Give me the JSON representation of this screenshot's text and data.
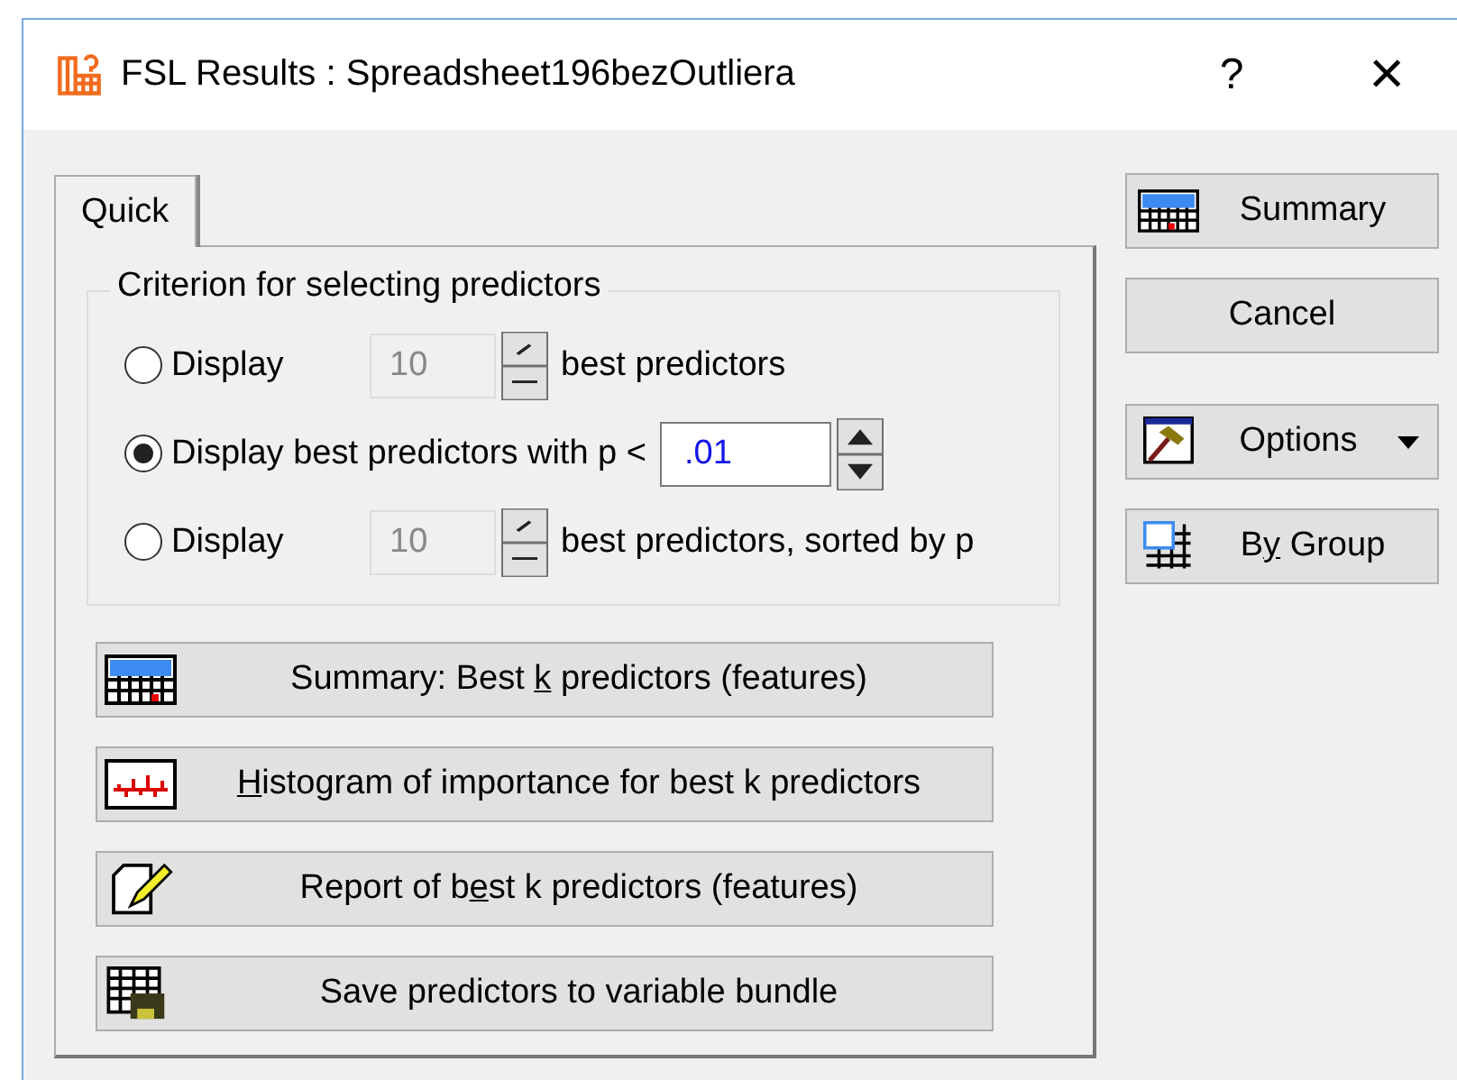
{
  "window": {
    "title": "FSL Results : Spreadsheet196bezOutliera",
    "help": "?",
    "close": "×"
  },
  "tabs": [
    {
      "label": "Quick",
      "selected": true
    }
  ],
  "criterion": {
    "title": "Criterion for selecting predictors",
    "options": [
      {
        "kind": "spin",
        "selected": false,
        "label": "Display",
        "value": "10",
        "disabled": true,
        "suffix": "best predictors"
      },
      {
        "kind": "threshold",
        "selected": true,
        "label": "Display best predictors with p <",
        "value": ".01",
        "disabled": false
      },
      {
        "kind": "spin",
        "selected": false,
        "label": "Display",
        "value": "10",
        "disabled": true,
        "suffix": "best predictors, sorted by p"
      }
    ]
  },
  "actions": [
    {
      "before": "Summary: Best ",
      "key": "k",
      "after": " predictors (features)"
    },
    {
      "key": "H",
      "after": "istogram of importance for best k predictors"
    },
    {
      "before": "Report of b",
      "key": "e",
      "after": "st k predictors (features)"
    },
    {
      "before": "Save predictors to variable bundle"
    }
  ],
  "side_buttons": [
    {
      "before": "Summary"
    },
    {
      "before": "Cancel"
    },
    {
      "before": "Options"
    },
    {
      "before": "B",
      "key": "y",
      "after": " Group"
    }
  ]
}
